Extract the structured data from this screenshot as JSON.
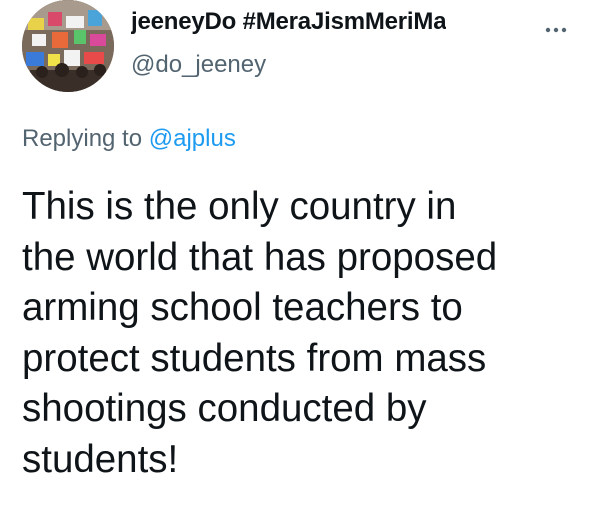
{
  "tweet": {
    "author": {
      "display_name": "jeeneyDo #MeraJismMeriMa",
      "handle": "@do_jeeney",
      "avatar_icon": "protest-crowd-avatar"
    },
    "more_icon": "more-horizontal-icon",
    "reply": {
      "prefix": "Replying to",
      "mention": "@ajplus"
    },
    "text_lines": [
      "This is the only country in",
      "the world that has proposed",
      "arming school teachers to",
      "protect students from mass",
      "shootings conducted by",
      "students!"
    ]
  },
  "colors": {
    "text": "#0f1419",
    "secondary": "#536471",
    "link": "#1d9bf0",
    "background": "#ffffff"
  }
}
